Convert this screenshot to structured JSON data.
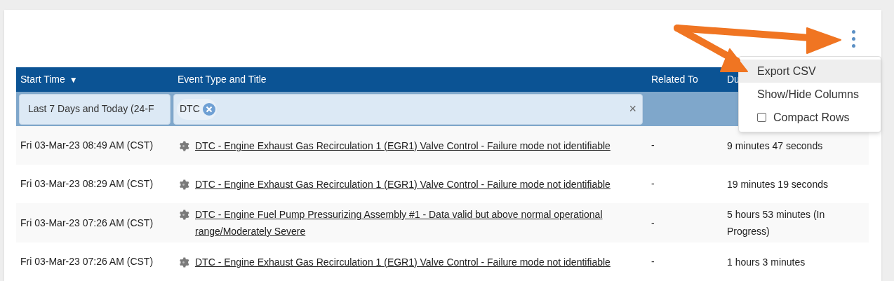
{
  "table": {
    "columns": [
      {
        "label": "Start Time",
        "sort": "▼"
      },
      {
        "label": "Event Type and Title"
      },
      {
        "label": "Related To"
      },
      {
        "label": "Du"
      }
    ],
    "filters": {
      "date": "Last 7 Days and Today (24-F",
      "event_chips": [
        "DTC"
      ],
      "clear": "×"
    },
    "rows": [
      {
        "start": "Fri 03-Mar-23 08:49 AM (CST)",
        "title": "DTC - Engine Exhaust Gas Recirculation 1 (EGR1) Valve Control - Failure mode not identifiable",
        "related": "-",
        "duration": "9 minutes 47 seconds"
      },
      {
        "start": "Fri 03-Mar-23 08:29 AM (CST)",
        "title": "DTC - Engine Exhaust Gas Recirculation 1 (EGR1) Valve Control - Failure mode not identifiable",
        "related": "-",
        "duration": "19 minutes 19 seconds"
      },
      {
        "start": "Fri 03-Mar-23 07:26 AM (CST)",
        "title": "DTC - Engine Fuel Pump Pressurizing Assembly #1 - Data valid but above normal operational range/Moderately Severe",
        "related": "-",
        "duration": "5 hours 53 minutes (In Progress)"
      },
      {
        "start": "Fri 03-Mar-23 07:26 AM (CST)",
        "title": "DTC - Engine Exhaust Gas Recirculation 1 (EGR1) Valve Control - Failure mode not identifiable",
        "related": "-",
        "duration": "1 hours 3 minutes"
      }
    ]
  },
  "menu": {
    "items": [
      {
        "kind": "action",
        "label": "Export CSV",
        "selected": true
      },
      {
        "kind": "action",
        "label": "Show/Hide Columns",
        "selected": false
      },
      {
        "kind": "checkbox",
        "label": "Compact Rows",
        "selected": false,
        "checked": false
      }
    ]
  }
}
